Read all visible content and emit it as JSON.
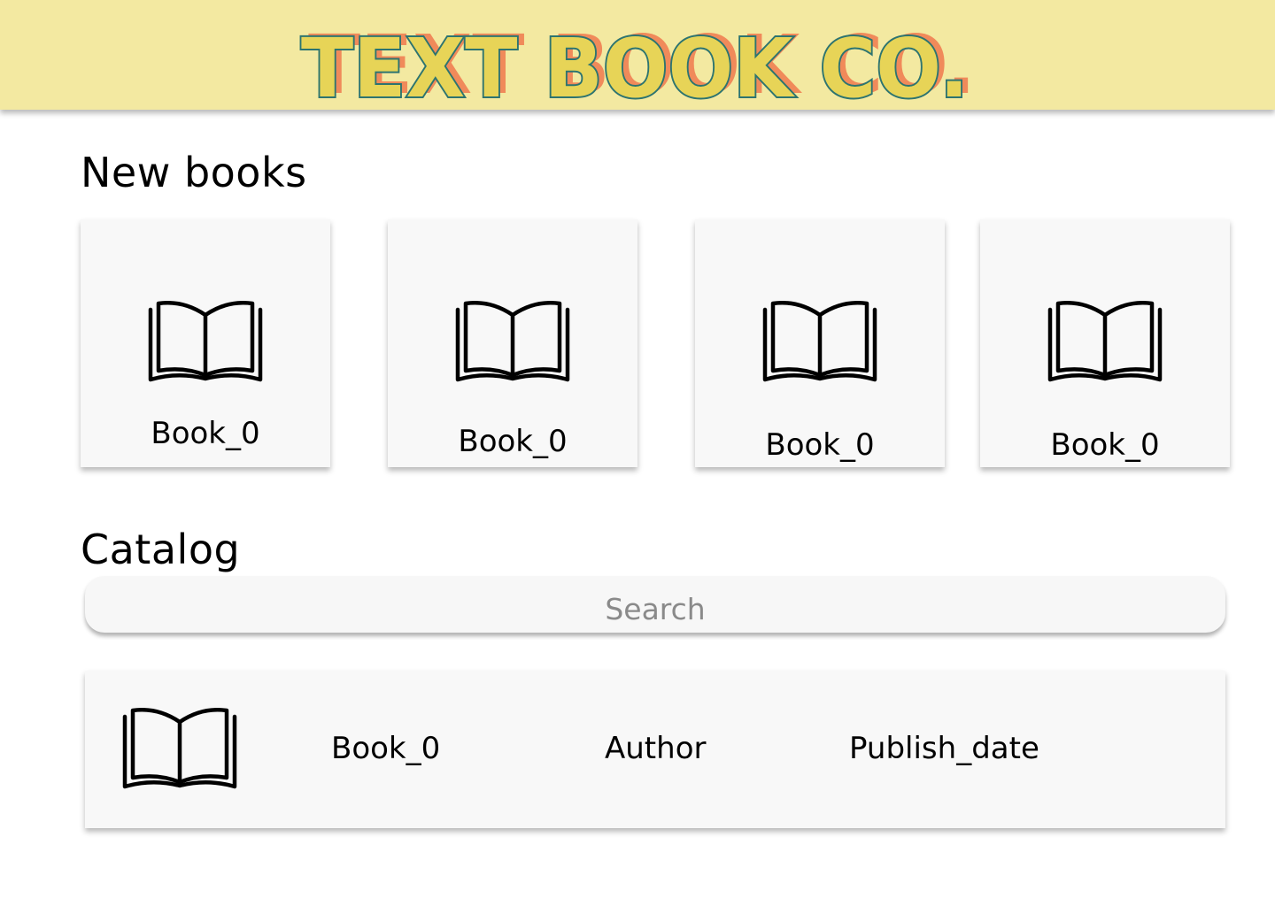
{
  "header": {
    "logo_text": "TEXT BOOK CO.",
    "colors": {
      "background": "#f3e9a1",
      "fill": "#e7d457",
      "outline": "#2d7470",
      "offset": "#f08a5a"
    }
  },
  "new_books": {
    "title": "New books",
    "items": [
      {
        "label": "Book_0",
        "icon": "book-icon"
      },
      {
        "label": "Book_0",
        "icon": "book-icon"
      },
      {
        "label": "Book_0",
        "icon": "book-icon"
      },
      {
        "label": "Book_0",
        "icon": "book-icon"
      }
    ]
  },
  "catalog": {
    "title": "Catalog",
    "search": {
      "placeholder": "Search",
      "value": ""
    },
    "rows": [
      {
        "title": "Book_0",
        "author": "Author",
        "publish_date": "Publish_date",
        "icon": "book-icon"
      }
    ]
  }
}
